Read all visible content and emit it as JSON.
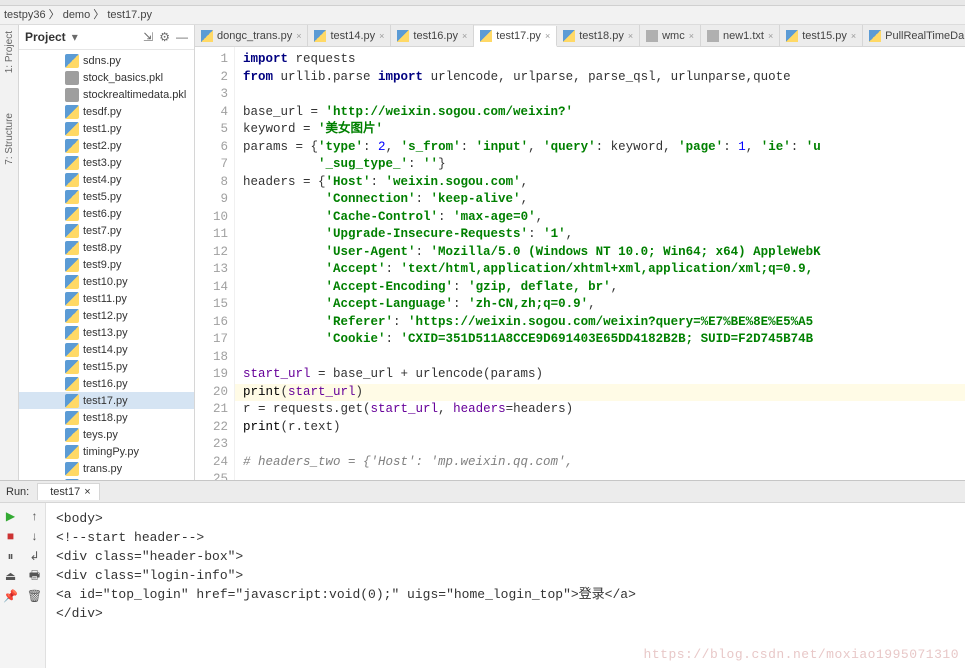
{
  "breadcrumb": "testpy36  〉 demo 〉  test17.py",
  "left_tool_labels": {
    "project": "1: Project",
    "structure": "7: Structure"
  },
  "project_pane": {
    "title": "Project",
    "icons": {
      "dropdown": "▾",
      "collapse": "⇲",
      "gear": "⚙",
      "hide": "—"
    },
    "items": [
      {
        "name": "sdns.py",
        "type": "py"
      },
      {
        "name": "stock_basics.pkl",
        "type": "pkl"
      },
      {
        "name": "stockrealtimedata.pkl",
        "type": "pkl"
      },
      {
        "name": "tesdf.py",
        "type": "py"
      },
      {
        "name": "test1.py",
        "type": "py"
      },
      {
        "name": "test2.py",
        "type": "py"
      },
      {
        "name": "test3.py",
        "type": "py"
      },
      {
        "name": "test4.py",
        "type": "py"
      },
      {
        "name": "test5.py",
        "type": "py"
      },
      {
        "name": "test6.py",
        "type": "py"
      },
      {
        "name": "test7.py",
        "type": "py"
      },
      {
        "name": "test8.py",
        "type": "py"
      },
      {
        "name": "test9.py",
        "type": "py"
      },
      {
        "name": "test10.py",
        "type": "py"
      },
      {
        "name": "test11.py",
        "type": "py"
      },
      {
        "name": "test12.py",
        "type": "py"
      },
      {
        "name": "test13.py",
        "type": "py"
      },
      {
        "name": "test14.py",
        "type": "py"
      },
      {
        "name": "test15.py",
        "type": "py"
      },
      {
        "name": "test16.py",
        "type": "py"
      },
      {
        "name": "test17.py",
        "type": "py",
        "selected": true
      },
      {
        "name": "test18.py",
        "type": "py"
      },
      {
        "name": "teys.py",
        "type": "py"
      },
      {
        "name": "timingPy.py",
        "type": "py"
      },
      {
        "name": "trans.py",
        "type": "py"
      },
      {
        "name": "trans_test.py",
        "type": "py"
      }
    ]
  },
  "tabs": [
    {
      "label": "dongc_trans.py",
      "type": "py"
    },
    {
      "label": "test14.py",
      "type": "py"
    },
    {
      "label": "test16.py",
      "type": "py"
    },
    {
      "label": "test17.py",
      "type": "py",
      "active": true
    },
    {
      "label": "test18.py",
      "type": "py"
    },
    {
      "label": "wmc",
      "type": "txt"
    },
    {
      "label": "new1.txt",
      "type": "txt"
    },
    {
      "label": "test15.py",
      "type": "py"
    },
    {
      "label": "PullRealTimeDa",
      "type": "py"
    }
  ],
  "editor": {
    "line_numbers": [
      1,
      2,
      3,
      4,
      5,
      6,
      7,
      8,
      9,
      10,
      11,
      12,
      13,
      14,
      15,
      16,
      17,
      18,
      19,
      20,
      21,
      22,
      23,
      24,
      25
    ],
    "highlight_line": 20,
    "lines_html": [
      "<span class='kw'>import</span> requests",
      "<span class='kw'>from</span> urllib.parse <span class='kw'>import</span> urlencode, urlparse, parse_qsl, urlunparse,quote",
      "",
      "base_url = <span class='str'>'http://weixin.sogou.com/weixin?'</span>",
      "keyword = <span class='str'>'美女图片'</span>",
      "params = {<span class='str'>'type'</span>: <span class='num'>2</span>, <span class='str'>'s_from'</span>: <span class='str'>'input'</span>, <span class='str'>'query'</span>: keyword, <span class='str'>'page'</span>: <span class='num'>1</span>, <span class='str'>'ie'</span>: <span class='str'>'u</span>",
      "          <span class='str'>'_sug_type_'</span>: <span class='str'>''</span>}",
      "headers = {<span class='str'>'Host'</span>: <span class='str'>'weixin.sogou.com'</span>,",
      "           <span class='str'>'Connection'</span>: <span class='str'>'keep-alive'</span>,",
      "           <span class='str'>'Cache-Control'</span>: <span class='str'>'max-age=0'</span>,",
      "           <span class='str'>'Upgrade-Insecure-Requests'</span>: <span class='str'>'1'</span>,",
      "           <span class='str'>'User-Agent'</span>: <span class='str'>'Mozilla/5.0 (Windows NT 10.0; Win64; x64) AppleWebK</span>",
      "           <span class='str'>'Accept'</span>: <span class='str'>'text/html,application/xhtml+xml,application/xml;q=0.9,</span>",
      "           <span class='str'>'Accept-Encoding'</span>: <span class='str'>'gzip, deflate, br'</span>,",
      "           <span class='str'>'Accept-Language'</span>: <span class='str'>'zh-CN,zh;q=0.9'</span>,",
      "           <span class='str'>'Referer'</span>: <span class='str'>'https://weixin.sogou.com/weixin?query=%E7%BE%8E%E5%A5</span>",
      "           <span class='str'>'Cookie'</span>: <span class='str'>'CXID=351D511A8CCE9D691403E65DD4182B2B; SUID=F2D745B74B</span>",
      "",
      "<span class='ident'>start_url</span> = base_url + urlencode(params)",
      "<span class='fn'>print</span>(<span class='ident'>start_url</span>)",
      "r = requests.get(<span class='ident'>start_url</span>, <span class='ident'>headers</span>=headers)",
      "<span class='fn'>print</span>(r.text)",
      "",
      "<span class='cmt'># headers_two = {'Host': 'mp.weixin.qq.com',</span>",
      ""
    ]
  },
  "run": {
    "label": "Run:",
    "tab": "test17",
    "output_lines": [
      "<body>",
      "",
      "<!--start header-->",
      "<div class=\"header-box\">",
      "",
      "    <div class=\"login-info\">",
      "        <a id=\"top_login\" href=\"javascript:void(0);\" uigs=\"home_login_top\">登录</a>",
      "    </div>"
    ],
    "tools": {
      "play": "▶",
      "up": "↑",
      "stop": "■",
      "down": "↓",
      "pause": "⏸",
      "wrap": "↲",
      "exit": "⏏",
      "print": "🖶",
      "pin": "📌",
      "trash": "🗑"
    }
  },
  "watermark": "https://blog.csdn.net/moxiao1995071310"
}
